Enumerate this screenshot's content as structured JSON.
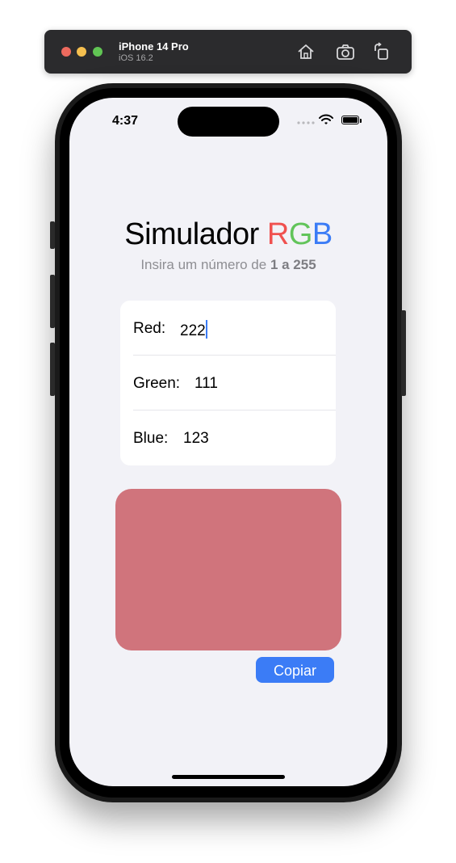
{
  "simulator": {
    "device": "iPhone 14 Pro",
    "os": "iOS 16.2",
    "home_icon": "home-icon",
    "screenshot_icon": "camera-icon",
    "rotate_icon": "rotate-icon"
  },
  "status_bar": {
    "time": "4:37",
    "icons": [
      "signal-dots-icon",
      "wifi-icon",
      "battery-icon"
    ]
  },
  "header": {
    "title_prefix": "Simulador ",
    "title_r": "R",
    "title_g": "G",
    "title_b": "B",
    "subtitle_prefix": "Insira um número de ",
    "subtitle_range": "1 a 255"
  },
  "form": {
    "red_label": "Red:",
    "red_value": "222",
    "green_label": "Green:",
    "green_value": "111",
    "blue_label": "Blue:",
    "blue_value": "123"
  },
  "preview": {
    "color": "#d0747c"
  },
  "actions": {
    "copy_label": "Copiar"
  },
  "colors": {
    "r_accent": "#f0514f",
    "g_accent": "#62c45a",
    "b_accent": "#3b7cf6",
    "background": "#f2f2f7"
  }
}
